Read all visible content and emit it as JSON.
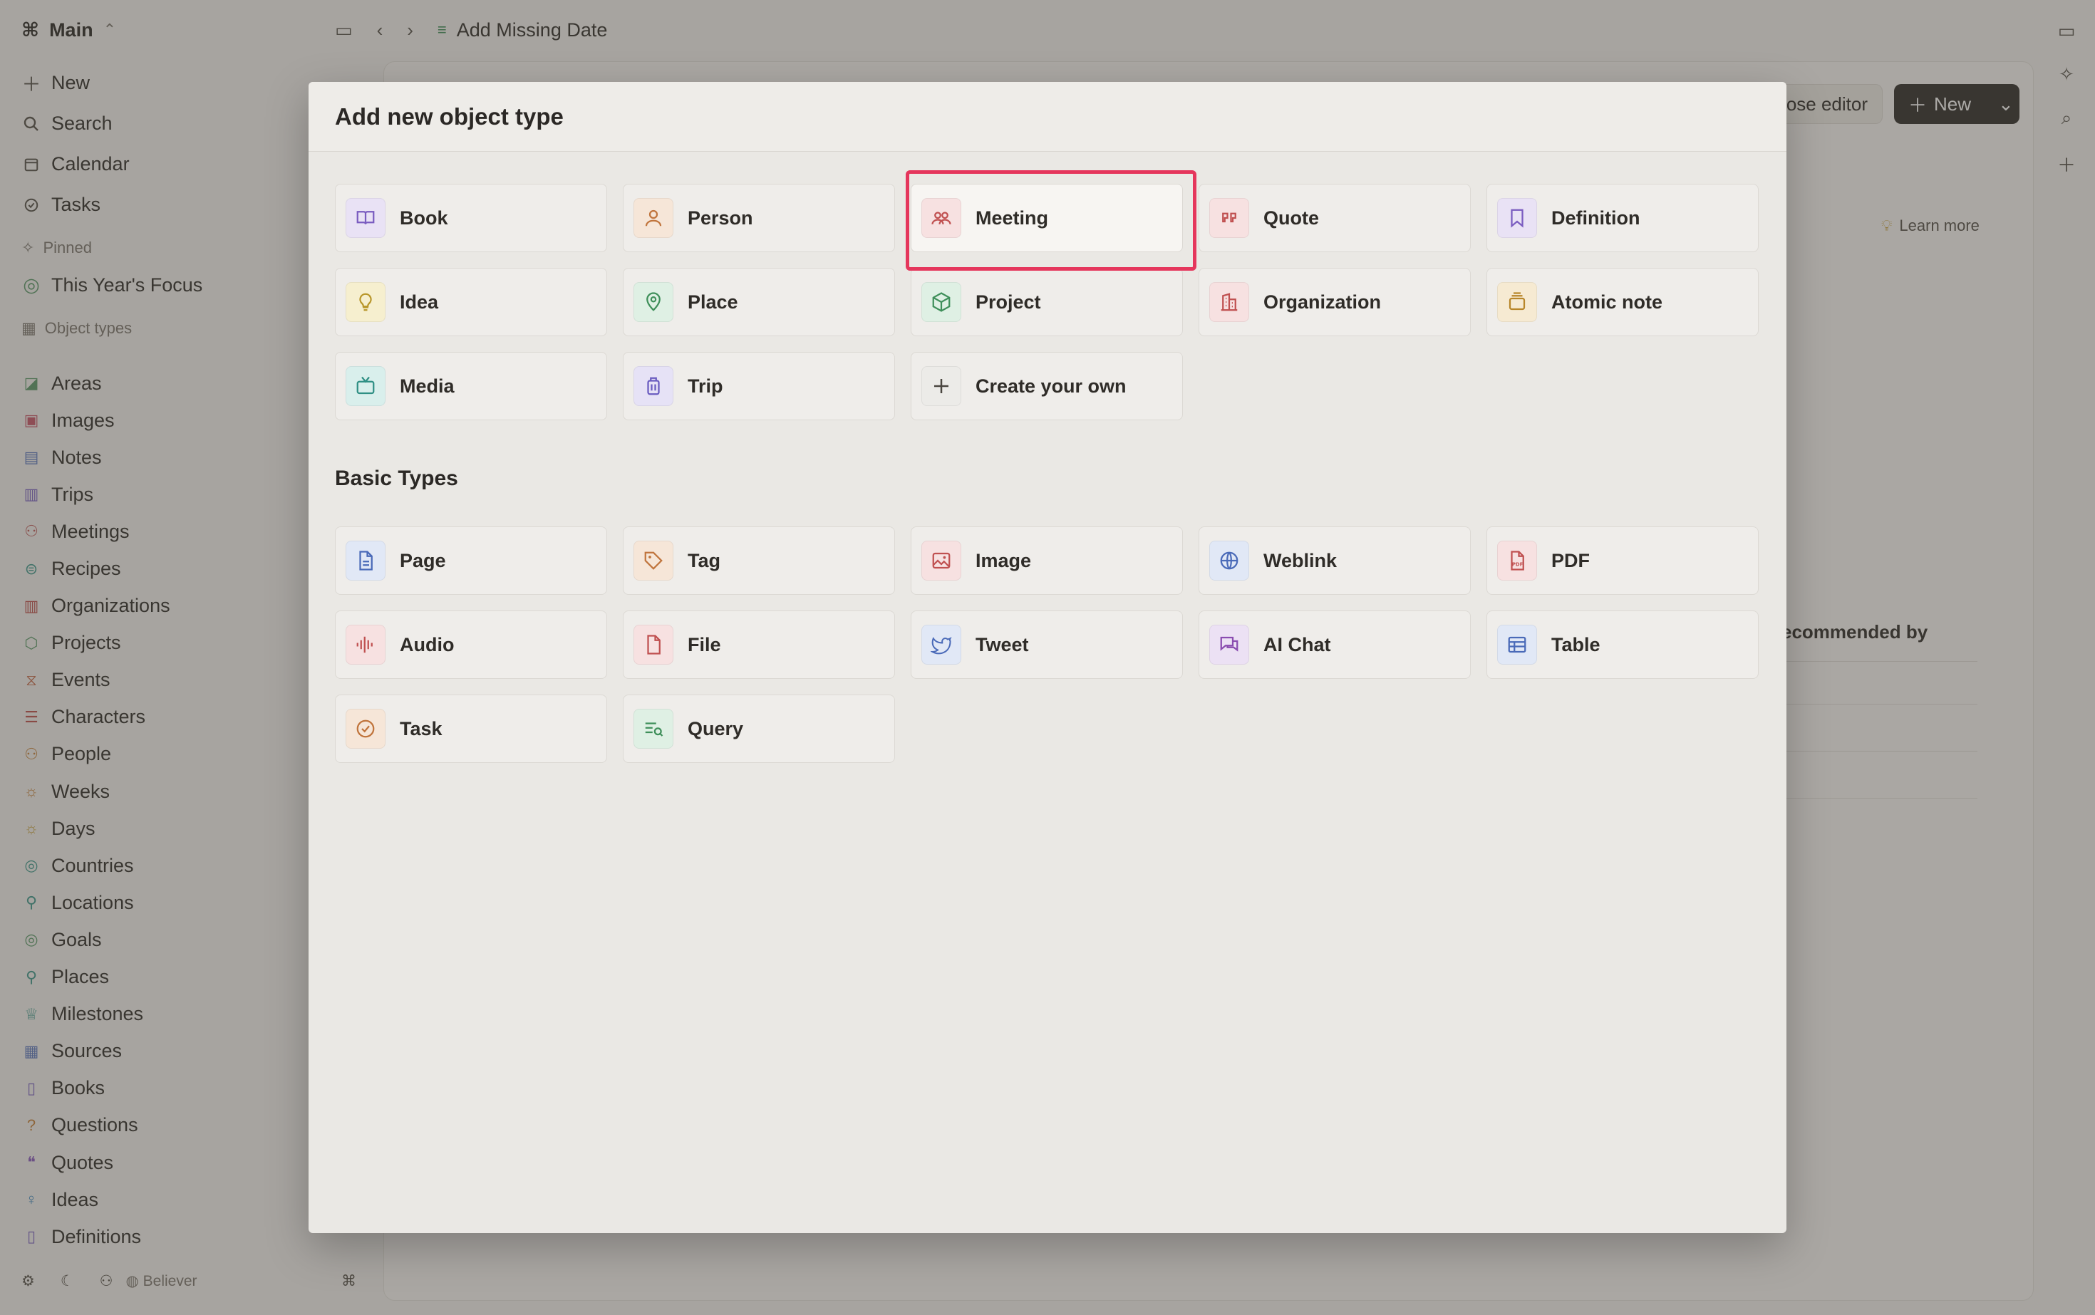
{
  "workspace": {
    "name": "Main"
  },
  "sidebar": {
    "top": [
      {
        "icon": "plus-icon",
        "label": "New"
      },
      {
        "icon": "search-icon",
        "label": "Search"
      },
      {
        "icon": "calendar-icon",
        "label": "Calendar"
      },
      {
        "icon": "check-circle-icon",
        "label": "Tasks"
      }
    ],
    "pinned_header": "Pinned",
    "pinned": [
      {
        "label": "This Year's Focus"
      }
    ],
    "object_types_header": "Object types",
    "object_types": [
      {
        "label": "Areas",
        "color": "#5a9a6a"
      },
      {
        "label": "Images",
        "color": "#c8576a"
      },
      {
        "label": "Notes",
        "color": "#5c78c2"
      },
      {
        "label": "Trips",
        "color": "#7f66c6"
      },
      {
        "label": "Meetings",
        "color": "#c05a5a"
      },
      {
        "label": "Recipes",
        "color": "#3f9a8e"
      },
      {
        "label": "Organizations",
        "color": "#c0504d"
      },
      {
        "label": "Projects",
        "color": "#5a9a6a"
      },
      {
        "label": "Events",
        "color": "#c96f50"
      },
      {
        "label": "Characters",
        "color": "#c0504d"
      },
      {
        "label": "People",
        "color": "#c9843c"
      },
      {
        "label": "Weeks",
        "color": "#c9843c"
      },
      {
        "label": "Days",
        "color": "#c9a23c"
      },
      {
        "label": "Countries",
        "color": "#3f9a8e"
      },
      {
        "label": "Locations",
        "color": "#3f9a8e"
      },
      {
        "label": "Goals",
        "color": "#5a9a6a"
      },
      {
        "label": "Places",
        "color": "#3f9a8e"
      },
      {
        "label": "Milestones",
        "color": "#3f9a8e"
      },
      {
        "label": "Sources",
        "color": "#5c78c2"
      },
      {
        "label": "Books",
        "color": "#7f66c6"
      },
      {
        "label": "Questions",
        "color": "#c9843c"
      },
      {
        "label": "Quotes",
        "color": "#8a5cc2"
      },
      {
        "label": "Ideas",
        "color": "#3f8ac2"
      },
      {
        "label": "Definitions",
        "color": "#7f66c6"
      }
    ],
    "footer_label": "Believer"
  },
  "topbar": {
    "breadcrumb": "Add Missing Date"
  },
  "background": {
    "editor_button": "ose editor",
    "new_button": "New",
    "learn_more": "Learn more",
    "column_header": "ecommended by"
  },
  "modal": {
    "title": "Add new object type",
    "suggested": [
      {
        "label": "Book",
        "icon": "book-icon",
        "bg": "#e9e2f5",
        "fg": "#7a5cc0"
      },
      {
        "label": "Person",
        "icon": "person-icon",
        "bg": "#f6e6d8",
        "fg": "#c0743c"
      },
      {
        "label": "Meeting",
        "icon": "people-group-icon",
        "bg": "#f7e1e1",
        "fg": "#c05050"
      },
      {
        "label": "Quote",
        "icon": "quote-icon",
        "bg": "#f7e1e1",
        "fg": "#c05050"
      },
      {
        "label": "Definition",
        "icon": "bookmark-icon",
        "bg": "#e9e2f5",
        "fg": "#7a5cc0"
      },
      {
        "label": "Idea",
        "icon": "lightbulb-icon",
        "bg": "#f6efcf",
        "fg": "#b8962a"
      },
      {
        "label": "Place",
        "icon": "map-pin-icon",
        "bg": "#dff0e4",
        "fg": "#3f8f5a"
      },
      {
        "label": "Project",
        "icon": "cube-icon",
        "bg": "#dff0e4",
        "fg": "#3f8f5a"
      },
      {
        "label": "Organization",
        "icon": "building-icon",
        "bg": "#f7e1e1",
        "fg": "#c05050"
      },
      {
        "label": "Atomic note",
        "icon": "card-stack-icon",
        "bg": "#f6ead2",
        "fg": "#b8862a"
      },
      {
        "label": "Media",
        "icon": "tv-icon",
        "bg": "#d9efec",
        "fg": "#2f8f84"
      },
      {
        "label": "Trip",
        "icon": "luggage-icon",
        "bg": "#e6e2f6",
        "fg": "#6a5cc0"
      },
      {
        "label": "Create your own",
        "icon": "plus-icon",
        "bg": "#ecebe8",
        "fg": "#4a4640"
      }
    ],
    "basic_title": "Basic Types",
    "basic": [
      {
        "label": "Page",
        "icon": "document-icon",
        "bg": "#e1e8f6",
        "fg": "#4a6ab8"
      },
      {
        "label": "Tag",
        "icon": "tag-icon",
        "bg": "#f6e6d8",
        "fg": "#c0743c"
      },
      {
        "label": "Image",
        "icon": "image-icon",
        "bg": "#f7e1e1",
        "fg": "#c05050"
      },
      {
        "label": "Weblink",
        "icon": "globe-icon",
        "bg": "#e1e8f6",
        "fg": "#4a6ab8"
      },
      {
        "label": "PDF",
        "icon": "pdf-icon",
        "bg": "#f7e1e1",
        "fg": "#c05050"
      },
      {
        "label": "Audio",
        "icon": "audio-wave-icon",
        "bg": "#f7e1e1",
        "fg": "#c05050"
      },
      {
        "label": "File",
        "icon": "file-icon",
        "bg": "#f7e1e1",
        "fg": "#c05050"
      },
      {
        "label": "Tweet",
        "icon": "bird-icon",
        "bg": "#e1e8f6",
        "fg": "#4a6ab8"
      },
      {
        "label": "AI Chat",
        "icon": "chat-icon",
        "bg": "#ece1f4",
        "fg": "#8a4cb0"
      },
      {
        "label": "Table",
        "icon": "table-icon",
        "bg": "#e1e8f6",
        "fg": "#4a6ab8"
      },
      {
        "label": "Task",
        "icon": "check-circle-icon",
        "bg": "#f6e6d8",
        "fg": "#c0743c"
      },
      {
        "label": "Query",
        "icon": "query-icon",
        "bg": "#dff0e4",
        "fg": "#3f8f5a"
      }
    ],
    "highlight_color": "#e5365c"
  }
}
